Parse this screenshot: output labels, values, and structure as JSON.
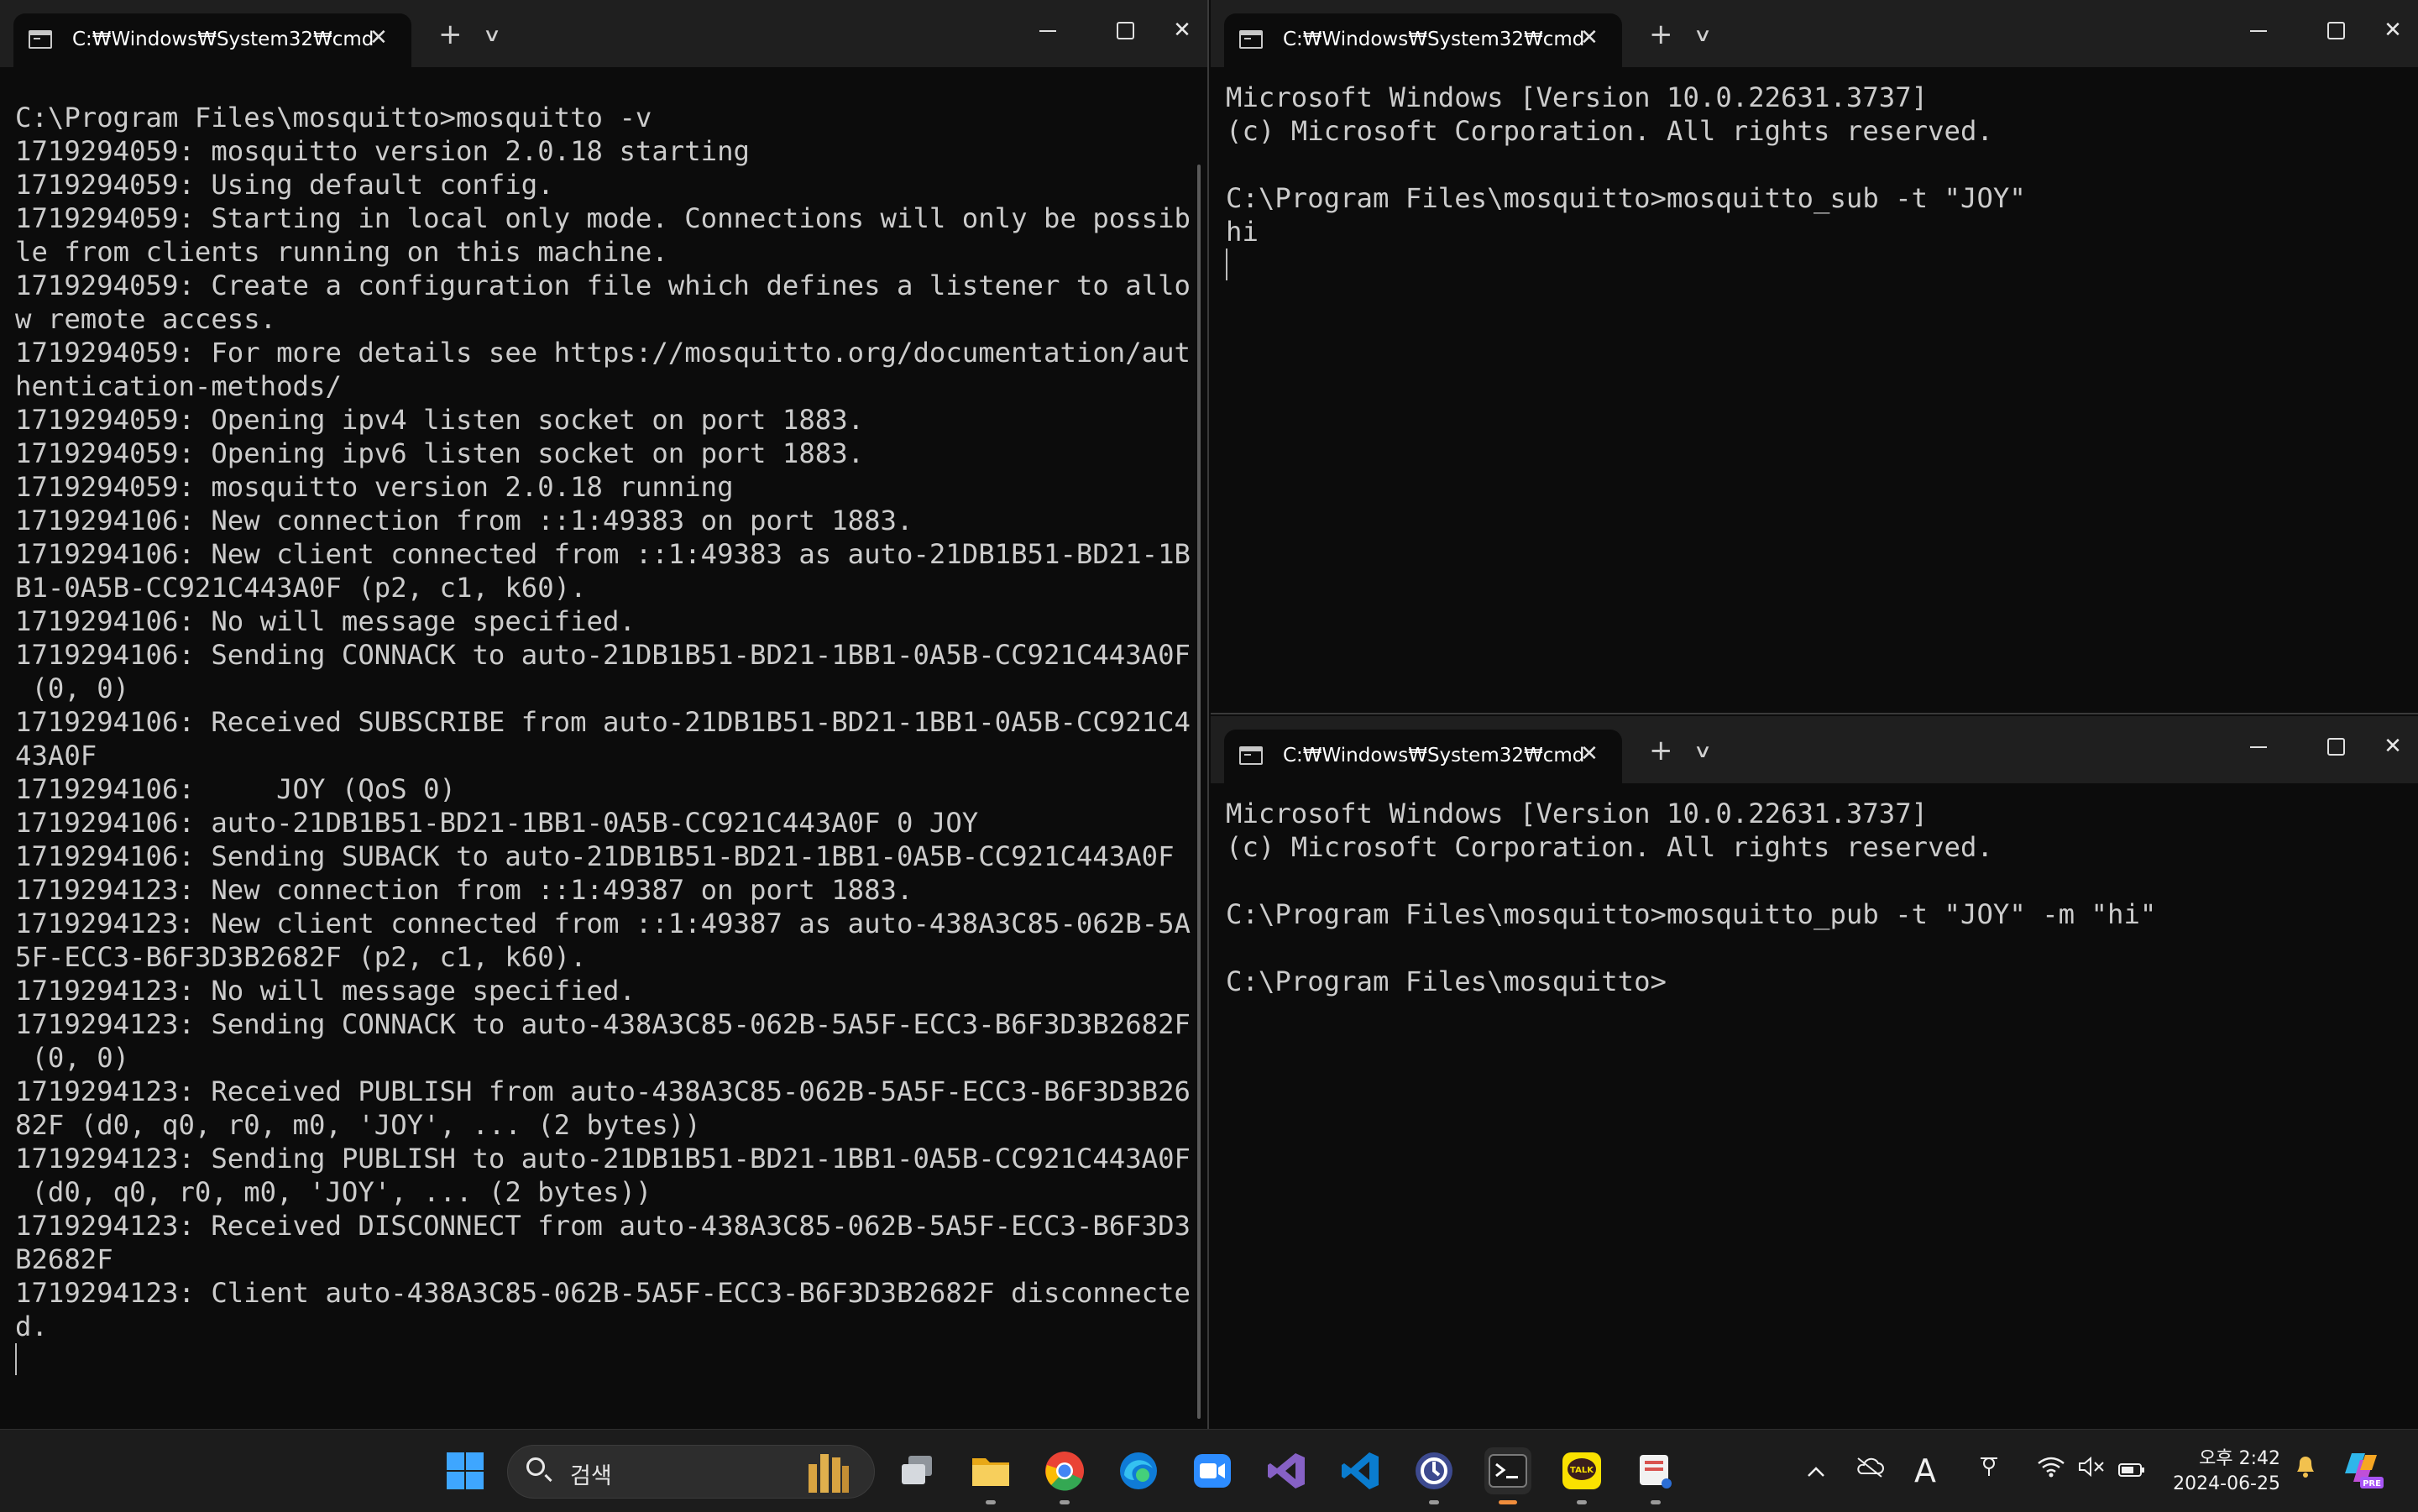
{
  "windows": {
    "left": {
      "tab_title": "C:₩Windows₩System32₩cmd",
      "lines": [
        "",
        "C:\\Program Files\\mosquitto>mosquitto -v",
        "1719294059: mosquitto version 2.0.18 starting",
        "1719294059: Using default config.",
        "1719294059: Starting in local only mode. Connections will only be possib",
        "le from clients running on this machine.",
        "1719294059: Create a configuration file which defines a listener to allo",
        "w remote access.",
        "1719294059: For more details see https://mosquitto.org/documentation/aut",
        "hentication-methods/",
        "1719294059: Opening ipv4 listen socket on port 1883.",
        "1719294059: Opening ipv6 listen socket on port 1883.",
        "1719294059: mosquitto version 2.0.18 running",
        "1719294106: New connection from ::1:49383 on port 1883.",
        "1719294106: New client connected from ::1:49383 as auto-21DB1B51-BD21-1B",
        "B1-0A5B-CC921C443A0F (p2, c1, k60).",
        "1719294106: No will message specified.",
        "1719294106: Sending CONNACK to auto-21DB1B51-BD21-1BB1-0A5B-CC921C443A0F",
        " (0, 0)",
        "1719294106: Received SUBSCRIBE from auto-21DB1B51-BD21-1BB1-0A5B-CC921C4",
        "43A0F",
        "1719294106:     JOY (QoS 0)",
        "1719294106: auto-21DB1B51-BD21-1BB1-0A5B-CC921C443A0F 0 JOY",
        "1719294106: Sending SUBACK to auto-21DB1B51-BD21-1BB1-0A5B-CC921C443A0F",
        "1719294123: New connection from ::1:49387 on port 1883.",
        "1719294123: New client connected from ::1:49387 as auto-438A3C85-062B-5A",
        "5F-ECC3-B6F3D3B2682F (p2, c1, k60).",
        "1719294123: No will message specified.",
        "1719294123: Sending CONNACK to auto-438A3C85-062B-5A5F-ECC3-B6F3D3B2682F",
        " (0, 0)",
        "1719294123: Received PUBLISH from auto-438A3C85-062B-5A5F-ECC3-B6F3D3B26",
        "82F (d0, q0, r0, m0, 'JOY', ... (2 bytes))",
        "1719294123: Sending PUBLISH to auto-21DB1B51-BD21-1BB1-0A5B-CC921C443A0F",
        " (d0, q0, r0, m0, 'JOY', ... (2 bytes))",
        "1719294123: Received DISCONNECT from auto-438A3C85-062B-5A5F-ECC3-B6F3D3",
        "B2682F",
        "1719294123: Client auto-438A3C85-062B-5A5F-ECC3-B6F3D3B2682F disconnecte",
        "d."
      ]
    },
    "top_right": {
      "tab_title": "C:₩Windows₩System32₩cmd",
      "lines": [
        "Microsoft Windows [Version 10.0.22631.3737]",
        "(c) Microsoft Corporation. All rights reserved.",
        "",
        "C:\\Program Files\\mosquitto>mosquitto_sub -t \"JOY\"",
        "hi"
      ]
    },
    "bottom_right": {
      "tab_title": "C:₩Windows₩System32₩cmd",
      "lines": [
        "Microsoft Windows [Version 10.0.22631.3737]",
        "(c) Microsoft Corporation. All rights reserved.",
        "",
        "C:\\Program Files\\mosquitto>mosquitto_pub -t \"JOY\" -m \"hi\"",
        "",
        "C:\\Program Files\\mosquitto>"
      ]
    }
  },
  "glyphs": {
    "tab_close": "✕",
    "new_tab": "+",
    "tab_dropdown": "∨",
    "window_close": "✕"
  },
  "taskbar": {
    "search_placeholder": "검색",
    "apps": [
      {
        "icon": "task-view-icon",
        "color": "#9aa0a6"
      },
      {
        "icon": "file-explorer-icon",
        "color": "#f5c451"
      },
      {
        "icon": "chrome-icon",
        "color": "#34a853"
      },
      {
        "icon": "edge-icon",
        "color": "#1fa0e3"
      },
      {
        "icon": "zoom-icon",
        "color": "#2d8cff"
      },
      {
        "icon": "visual-studio-icon",
        "color": "#8661c5"
      },
      {
        "icon": "vscode-icon",
        "color": "#0a7ccf"
      },
      {
        "icon": "clock-app-icon",
        "color": "#3d4a8f"
      },
      {
        "icon": "terminal-icon",
        "color": "#2b2b2b"
      },
      {
        "icon": "kakaotalk-icon",
        "color": "#fae100"
      },
      {
        "icon": "snipping-tool-icon",
        "color": "#e0e0e0"
      }
    ],
    "kakaotalk_label": "TALK",
    "tray": {
      "font_indicator": "A",
      "clock_time": "오후 2:42",
      "clock_date": "2024-06-25",
      "copilot_badge": "PRE"
    }
  },
  "colors": {
    "console_text": "#cccccc",
    "console_bg": "#0c0c0c",
    "titlebar_bg": "#1f1f1f",
    "taskbar_bg": "#1c1c1c"
  }
}
